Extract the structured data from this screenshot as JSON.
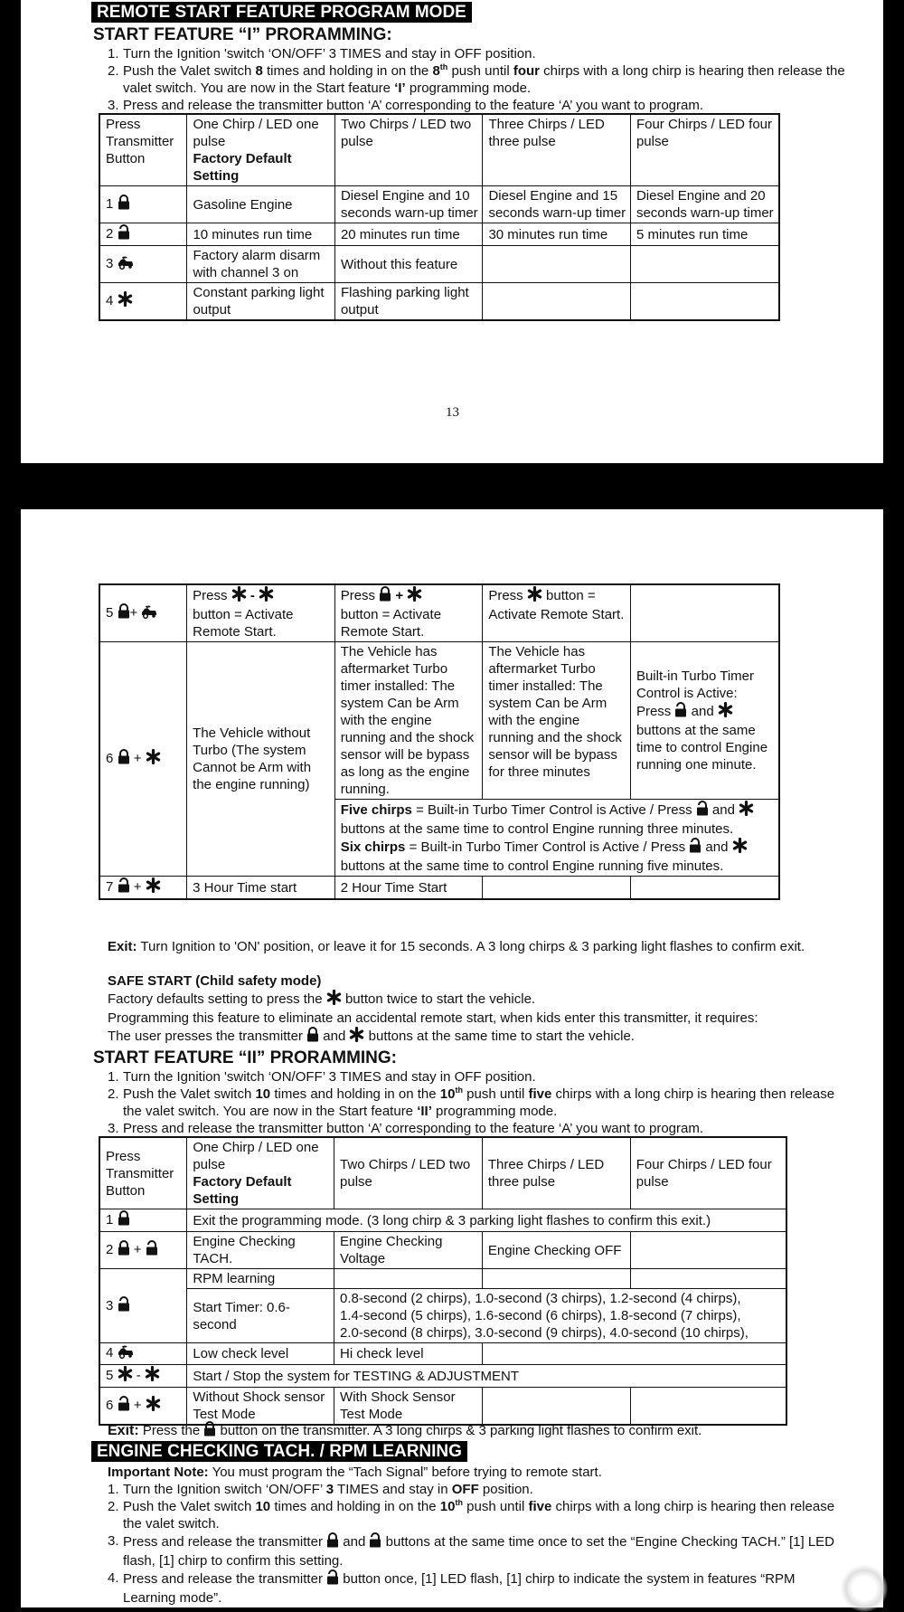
{
  "page1": {
    "banner": "REMOTE START FEATURE PROGRAM MODE",
    "heading": "START FEATURE “I” PRORAMMING:",
    "steps": [
      {
        "num": "1.",
        "text": "Turn the Ignition 'switch ‘ON/OFF’ 3 TIMES and stay in OFF position."
      },
      {
        "num": "2.",
        "pre": "Push the Valet switch ",
        "b1": "8",
        "mid1": " times and holding in on the ",
        "b2": "8",
        "sup": "th",
        "mid2": " push until ",
        "b3": "four",
        "post": " chirps with a long chirp is hearing then release the valet switch. You are now in the Start feature ",
        "b4": "‘I’",
        "end": " programming mode."
      },
      {
        "num": "3.",
        "text": "Press and release the transmitter button ‘A’ corresponding to the feature ‘A’ you want to program."
      }
    ],
    "table": {
      "header": {
        "col0": "Press Transmitter Button",
        "col1a": "One Chirp / LED one pulse",
        "col1b": "Factory Default Setting",
        "col2": "Two Chirps / LED two pulse",
        "col3": "Three Chirps / LED three pulse",
        "col4": "Four Chirps / LED four pulse"
      },
      "rows": [
        {
          "num": "1",
          "icons": [
            "lock-icon"
          ],
          "cells": [
            "Gasoline Engine",
            "Diesel Engine and 10 seconds warn-up timer",
            "Diesel Engine and 15 seconds warn-up timer",
            "Diesel Engine and 20 seconds warn-up timer"
          ]
        },
        {
          "num": "2",
          "icons": [
            "unlock-icon"
          ],
          "cells": [
            "10 minutes run time",
            "20 minutes run time",
            "30 minutes run time",
            "5 minutes run time"
          ]
        },
        {
          "num": "3",
          "icons": [
            "trunk-icon"
          ],
          "cells": [
            "Factory alarm disarm with channel 3 on",
            "Without this feature",
            "",
            ""
          ]
        },
        {
          "num": "4",
          "icons": [
            "star-icon"
          ],
          "cells": [
            "Constant parking light output",
            "Flashing parking light output",
            "",
            ""
          ]
        }
      ]
    },
    "page_number": "13"
  },
  "page2": {
    "table1": {
      "row5": {
        "num": "5",
        "plus": "+",
        "c1_pre": "Press",
        "c1_sep": "-",
        "c1_post": "button = Activate Remote Start.",
        "c2_pre": "Press",
        "c2_sep": "+",
        "c2_post": "button = Activate Remote Start.",
        "c3_pre": "Press",
        "c3_post": "button = Activate Remote Start.",
        "c4": ""
      },
      "row6": {
        "num": "6",
        "plus": "+",
        "c1": "The Vehicle without Turbo (The system Cannot be Arm with the engine running)",
        "c2": "The Vehicle has aftermarket Turbo timer installed: The system Can be Arm with the engine running and the shock sensor will be bypass as long as the engine running.",
        "c3": "The Vehicle has aftermarket Turbo timer installed: The system Can be Arm with the engine running and the shock sensor will be bypass for three minutes",
        "c4_pre": "Built-in Turbo Timer Control is Active: Press",
        "c4_and": "and",
        "c4_post": "buttons at the same time to control Engine running one minute.",
        "five_b": "Five chirps",
        "five_pre": " = Built-in Turbo Timer Control is Active / Press ",
        "five_and": " and ",
        "five_post": " buttons at the same time to control Engine running three minutes.",
        "six_b": "Six chirps",
        "six_pre": " = Built-in Turbo Timer Control is Active / Press ",
        "six_and": " and ",
        "six_post": " buttons at the same time to control Engine running five minutes."
      },
      "row7": {
        "num": "7",
        "plus": "+",
        "c1": "3 Hour Time start",
        "c2": "2 Hour Time Start",
        "c3": "",
        "c4": ""
      }
    },
    "exit1": {
      "label": "Exit:",
      "text": " Turn Ignition to 'ON' position, or leave it for 15 seconds. A 3 long chirps & 3 parking light flashes to confirm exit."
    },
    "safe_start": {
      "title": "SAFE START (Child safety mode)",
      "line1_pre": "Factory defaults setting to press the",
      "line1_post": "button twice to start the vehicle.",
      "line2": "Programming this feature to eliminate an accidental remote start, when kids enter this transmitter, it requires:",
      "line3_pre": "The user presses the transmitter",
      "line3_and": "and",
      "line3_post": "buttons at the same time to start the vehicle."
    },
    "heading2": "START FEATURE “II” PRORAMMING:",
    "steps2": [
      {
        "num": "1.",
        "text": "Turn the Ignition 'switch ‘ON/OFF’ 3 TIMES and stay in OFF position."
      },
      {
        "num": "2.",
        "pre": "Push the Valet switch ",
        "b1": "10",
        "mid1": " times and holding in on the ",
        "b2": "10",
        "sup": "th",
        "mid2": " push until ",
        "b3": "five",
        "post": " chirps with a long chirp is hearing then release the valet switch. You are now in the Start feature ",
        "b4": "‘II’",
        "end": " programming mode."
      },
      {
        "num": "3.",
        "text": "Press and release the transmitter button ‘A’ corresponding to the feature ‘A’ you want to program."
      }
    ],
    "table2": {
      "header": {
        "col0": "Press Transmitter Button",
        "col1a": "One Chirp / LED one pulse",
        "col1b": "Factory Default Setting",
        "col2": "Two Chirps / LED two pulse",
        "col3": "Three Chirps / LED three pulse",
        "col4": "Four Chirps / LED four pulse"
      },
      "row1": {
        "num": "1",
        "text": "Exit the programming mode. (3 long chirp & 3 parking light flashes to confirm this exit.)"
      },
      "row2": {
        "num": "2",
        "plus": "+",
        "cells": [
          "Engine Checking TACH.",
          "Engine Checking Voltage",
          "Engine Checking OFF",
          ""
        ]
      },
      "row3": {
        "num": "3",
        "rpm": "RPM learning",
        "timer": "Start Timer: 0.6-second",
        "timer_options": [
          "0.8-second (2 chirps), 1.0-second (3 chirps), 1.2-second (4 chirps),",
          "1.4-second (5 chirps), 1.6-second (6 chirps), 1.8-second (7 chirps),",
          "2.0-second (8 chirps), 3.0-second (9 chirps), 4.0-second (10 chirps),"
        ]
      },
      "row4": {
        "num": "4",
        "cells": [
          "Low check level",
          "Hi check level",
          ""
        ]
      },
      "row5": {
        "num": "5",
        "sep": "-",
        "text": "Start / Stop the system for TESTING & ADJUSTMENT"
      },
      "row6": {
        "num": "6",
        "plus": "+",
        "cells": [
          "Without Shock sensor Test Mode",
          "With Shock Sensor Test Mode",
          "",
          ""
        ]
      }
    },
    "exit2": {
      "label": "Exit:",
      "pre": " Press the",
      "post": "button on the transmitter. A 3 long chirps & 3 parking light flashes to confirm exit."
    },
    "banner2": "ENGINE CHECKING TACH. / RPM LEARNING",
    "note": {
      "label": "Important Note:",
      "text": " You must program the “Tach Signal” before trying to remote start."
    },
    "steps3": [
      {
        "num": "1.",
        "pre": "Turn the Ignition switch ‘ON/OFF’ ",
        "b1": "3",
        "mid": " TIMES and stay in ",
        "b2": "OFF",
        "post": " position."
      },
      {
        "num": "2.",
        "pre": "Push the Valet switch ",
        "b1": "10",
        "mid1": " times and holding in on the ",
        "b2": "10",
        "sup": "th",
        "mid2": " push until ",
        "b3": "five",
        "post": " chirps with a long chirp is hearing then release the valet switch."
      },
      {
        "num": "3.",
        "pre": "Press and release the transmitter",
        "and": "and",
        "post": "buttons at the same time once to set the “Engine Checking TACH.” [1] LED flash, [1] chirp to confirm this setting."
      },
      {
        "num": "4.",
        "pre": "Press and release the transmitter",
        "post": "button once, [1] LED flash, [1] chirp to indicate the system in features “RPM Learning mode”."
      }
    ]
  }
}
